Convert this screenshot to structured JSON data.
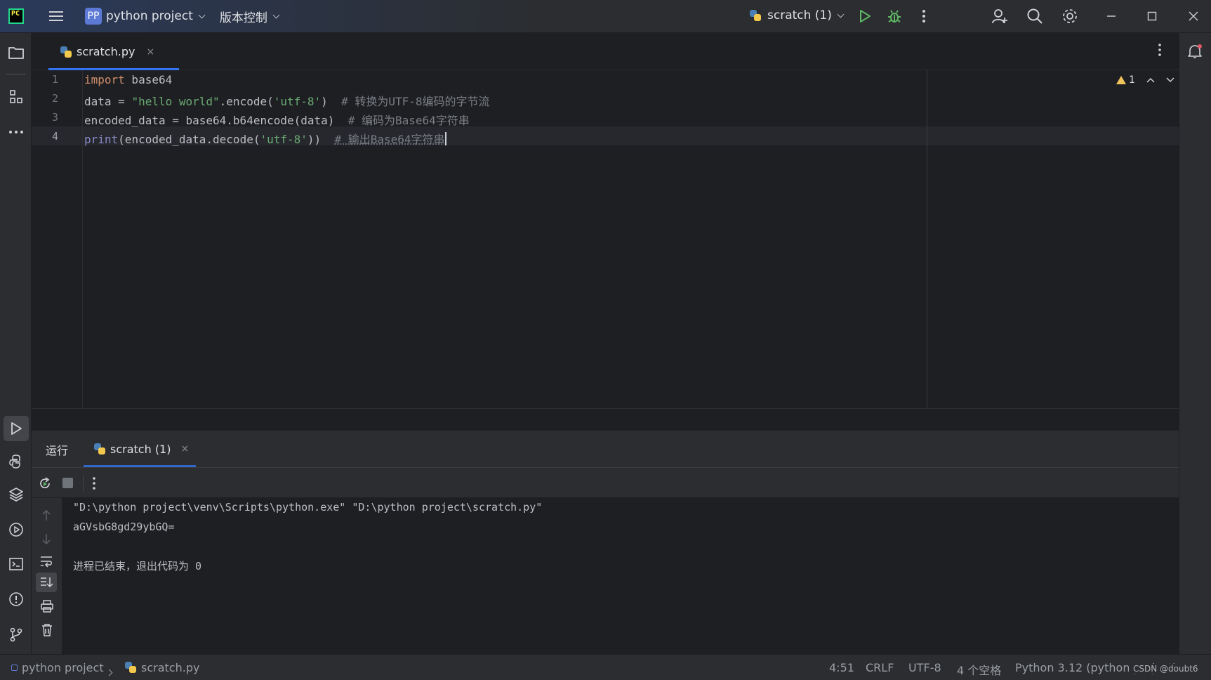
{
  "titlebar": {
    "project_badge": "PP",
    "project_name": "python project",
    "vcs_menu": "版本控制",
    "run_config": "scratch (1)"
  },
  "editor": {
    "tab_label": "scratch.py",
    "tab_close": "×",
    "inspection_count": "1",
    "line_numbers": [
      "1",
      "2",
      "3",
      "4"
    ],
    "lines": [
      {
        "t1": "import",
        "t2": " base64"
      },
      {
        "t1": "data = ",
        "t2": "\"hello world\"",
        "t3": ".encode(",
        "t4": "'utf-8'",
        "t5": ")  ",
        "t6": "# 转换为UTF-8编码的字节流"
      },
      {
        "t1": "encoded_data = base64.b64encode(data)  ",
        "t2": "# 编码为Base64字符串"
      },
      {
        "t1": "print",
        "t2": "(encoded_data.decode(",
        "t3": "'utf-8'",
        "t4": "))  ",
        "t5": "# 输出Base64字符串"
      }
    ]
  },
  "run_window": {
    "title": "运行",
    "tab_label": "scratch (1)",
    "tab_close": "×",
    "console": [
      "\"D:\\python project\\venv\\Scripts\\python.exe\" \"D:\\python project\\scratch.py\"",
      "aGVsbG8gd29ybGQ=",
      "",
      "进程已结束，退出代码为 0"
    ]
  },
  "statusbar": {
    "project": "python project",
    "file": "scratch.py",
    "position": "4:51",
    "line_sep": "CRLF",
    "encoding": "UTF-8",
    "indent": "4 个空格",
    "interpreter": "Python 3.12 (python project)",
    "watermark": "CSDN @doubt6"
  }
}
